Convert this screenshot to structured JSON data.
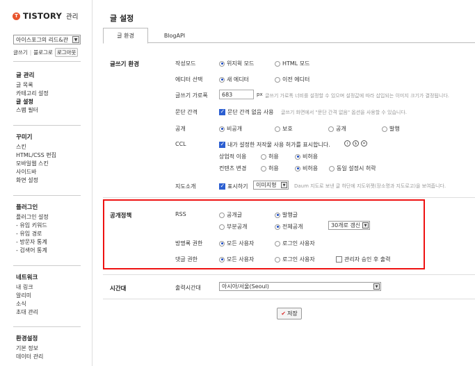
{
  "sidebar": {
    "logo_mark": "T",
    "logo": "TISTORY",
    "logo_sub": "관리",
    "blog_select": "아이스포그의 리드&관",
    "quick": [
      "글쓰기",
      "블로그로",
      "로그아웃"
    ],
    "groups": [
      {
        "head": "글 관리",
        "items": [
          "글 목록",
          "카테고리 설정",
          "글 설정",
          "스팸 필터"
        ]
      },
      {
        "head": "꾸미기",
        "items": [
          "스킨",
          "HTML/CSS 편집",
          "모바일웹 스킨",
          "사이드바",
          "화면 설정"
        ]
      },
      {
        "head": "플러그인",
        "items": [
          "플러그인 설정",
          "- 유입 키워드",
          "- 유입 경로",
          "- 방문자 통계",
          "- 검색어 통계"
        ]
      },
      {
        "head": "네트워크",
        "items": [
          "내 링크",
          "알리미",
          "소식",
          "초대 관리"
        ]
      },
      {
        "head": "환경설정",
        "items": [
          "기본 정보",
          "데이터 관리"
        ]
      }
    ]
  },
  "main": {
    "title": "글 설정",
    "tabs": [
      "글 환경",
      "BlogAPI"
    ],
    "writing": {
      "section": "글쓰기 환경",
      "mode_label": "작성모드",
      "mode_opts": [
        "위지윅 모드",
        "HTML 모드"
      ],
      "editor_label": "에디터 선택",
      "editor_opts": [
        "새 에디터",
        "이전 에디터"
      ],
      "width_label": "글쓰기 가로폭",
      "width_value": "683",
      "width_unit": "px",
      "width_note": "글쓰기 가로폭 너비를 설정할 수 있으며 설정값에 따라 삽입되는 이미지 크기가 결정됩니다.",
      "para_label": "문단 간격",
      "para_check": "문단 간격 없음 사용",
      "para_note": "글쓰기 화면에서 \"문단 간격 없음\" 옵션을 사용할 수 있습니다.",
      "public_label": "공개",
      "public_opts": [
        "비공개",
        "보호",
        "공개",
        "발행"
      ],
      "ccl_label": "CCL",
      "ccl_check": "내가 설정한 저작물 사용 허가를 표시합니다.",
      "ccl_icons": [
        "i",
        "$",
        "="
      ],
      "commercial_label": "상업적 이용",
      "commercial_opts": [
        "허용",
        "비허용"
      ],
      "modify_label": "컨텐츠 변경",
      "modify_opts": [
        "허용",
        "비허용",
        "동일 설정시 허락"
      ],
      "map_label": "지도소개",
      "map_check": "표시하기",
      "map_select": "이미지형",
      "map_note": "Daum 지도로 보낸 글 하단에 지도위젯(장소명과 지도로고)을 보여줍니다."
    },
    "policy": {
      "section": "공개정책",
      "rss_label": "RSS",
      "rss_row1": [
        "공개글",
        "발행글"
      ],
      "rss_row2": [
        "부분공개",
        "전체공개"
      ],
      "rss_count": "30개로 갱신",
      "guestbook_label": "방명록 권한",
      "guestbook_opts": [
        "모든 사용자",
        "로그인 사용자"
      ],
      "comment_label": "댓글 권한",
      "comment_opts": [
        "모든 사용자",
        "로그인 사용자"
      ],
      "comment_check": "관리자 승인 후 출력"
    },
    "timezone": {
      "section": "시간대",
      "label": "출력시간대",
      "value": "아시아/서울(Seoul)"
    },
    "save": "저장"
  },
  "colors": {
    "accent": "#e8532b",
    "highlight": "#ee1111",
    "radio": "#1a4ac4"
  }
}
